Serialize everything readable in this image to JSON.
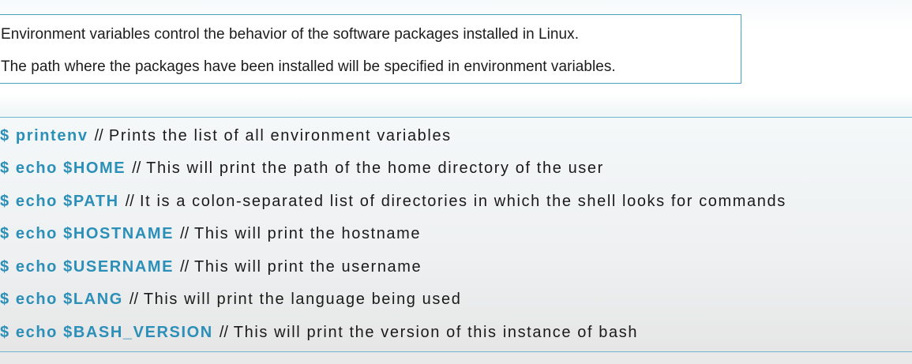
{
  "intro": {
    "line1": "Environment variables control the behavior of the software packages installed in Linux.",
    "line2": "The path where the packages have been installed will be specified in environment variables."
  },
  "commands": [
    {
      "cmd": "$ printenv",
      "sep": "//",
      "desc": "Prints the list of all environment variables"
    },
    {
      "cmd": "$ echo $HOME",
      "sep": "//",
      "desc": "This will print the path of the home directory of the user"
    },
    {
      "cmd": "$ echo $PATH",
      "sep": "//",
      "desc": "It is a colon-separated list of directories in which the shell looks for commands"
    },
    {
      "cmd": "$ echo $HOSTNAME",
      "sep": "//",
      "desc": "This will print the hostname"
    },
    {
      "cmd": "$ echo $USERNAME",
      "sep": "//",
      "desc": "This will print the username"
    },
    {
      "cmd": "$ echo $LANG",
      "sep": "//",
      "desc": "This will print the language being used"
    },
    {
      "cmd": "$ echo $BASH_VERSION",
      "sep": "//",
      "desc": "This will print the version of this instance of bash"
    }
  ],
  "colors": {
    "command": "#2b8fb8",
    "border": "#4aa3bd",
    "text": "#1a1a1a"
  }
}
